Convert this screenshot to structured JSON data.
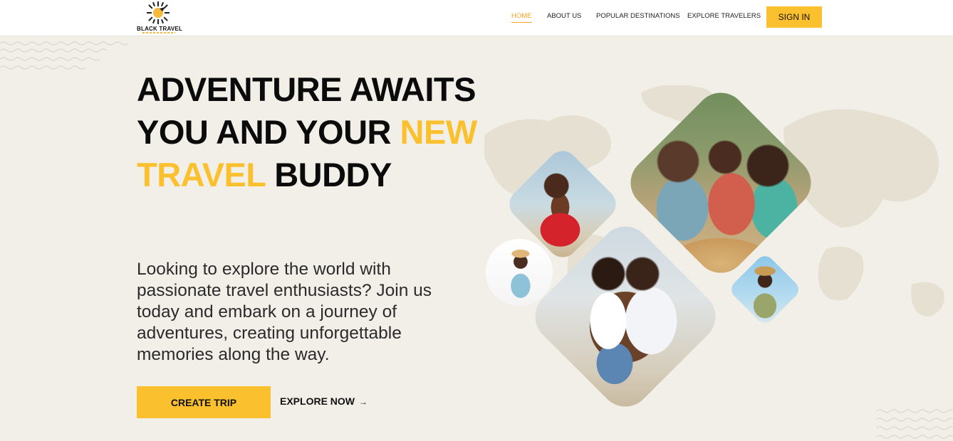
{
  "brand": {
    "logo_text": "BLACK TRAVEL"
  },
  "nav": {
    "items": [
      {
        "label": "HOME",
        "active": true
      },
      {
        "label": "ABOUT US",
        "active": false
      },
      {
        "label": "POPULAR DESTINATIONS",
        "active": false
      },
      {
        "label": "EXPLORE TRAVELERS",
        "active": false
      }
    ],
    "signin_label": "SIGN IN"
  },
  "hero": {
    "title_part1": "ADVENTURE AWAITS YOU AND YOUR ",
    "title_highlight": "NEW TRAVEL",
    "title_part2": " BUDDY",
    "description": "Looking to explore the world with passionate travel enthusiasts? Join us today and embark on a journey of adventures, creating unforgettable memories along the way.",
    "create_trip_label": "CREATE TRIP",
    "explore_now_label": "EXPLORE NOW",
    "explore_icon": "arrow-right-icon"
  },
  "colors": {
    "accent": "#fbc02d",
    "background": "#f2efe9",
    "text": "#0b0b0b"
  }
}
